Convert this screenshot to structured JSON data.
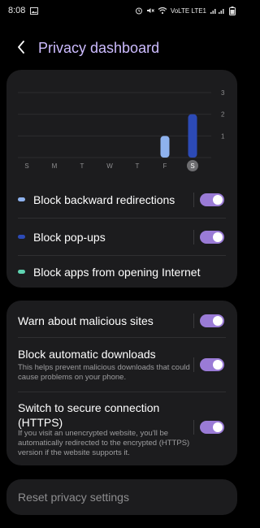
{
  "status": {
    "time": "8:08",
    "network": "VoLTE LTE1"
  },
  "header": {
    "title": "Privacy dashboard"
  },
  "chart_data": {
    "type": "bar",
    "categories": [
      "S",
      "M",
      "T",
      "W",
      "T",
      "F",
      "S"
    ],
    "series": [
      {
        "name": "Block backward redirections",
        "values": [
          0,
          0,
          0,
          0,
          0,
          1,
          0
        ]
      },
      {
        "name": "Block pop-ups",
        "values": [
          0,
          0,
          0,
          0,
          0,
          0,
          2
        ]
      }
    ],
    "yticks": [
      "1",
      "2",
      "3"
    ],
    "ylim": [
      0,
      3
    ],
    "highlight_day_index": 6,
    "colors": {
      "series1": "#8eb2ee",
      "series2": "#2c4ab6",
      "highlight": "#6d6d70"
    }
  },
  "legend": {
    "items": [
      {
        "label": "Block backward redirections",
        "color": "#8eb2ee",
        "toggle_on": true
      },
      {
        "label": "Block pop-ups",
        "color": "#2c4ab6",
        "toggle_on": true
      },
      {
        "label": "Block apps from opening Internet",
        "color": "#5fd3b1"
      }
    ]
  },
  "settings": {
    "warn": {
      "title": "Warn about malicious sites",
      "on": true
    },
    "downloads": {
      "title": "Block automatic downloads",
      "desc": "This helps prevent malicious downloads that could cause problems on your phone.",
      "on": true
    },
    "https": {
      "title": "Switch to secure connection (HTTPS)",
      "desc": "If you visit an unencrypted website, you'll be automatically redirected to the encrypted (HTTPS) version if the website supports it.",
      "on": true
    }
  },
  "reset": {
    "label": "Reset privacy settings"
  },
  "accent": "#9a7bd6"
}
